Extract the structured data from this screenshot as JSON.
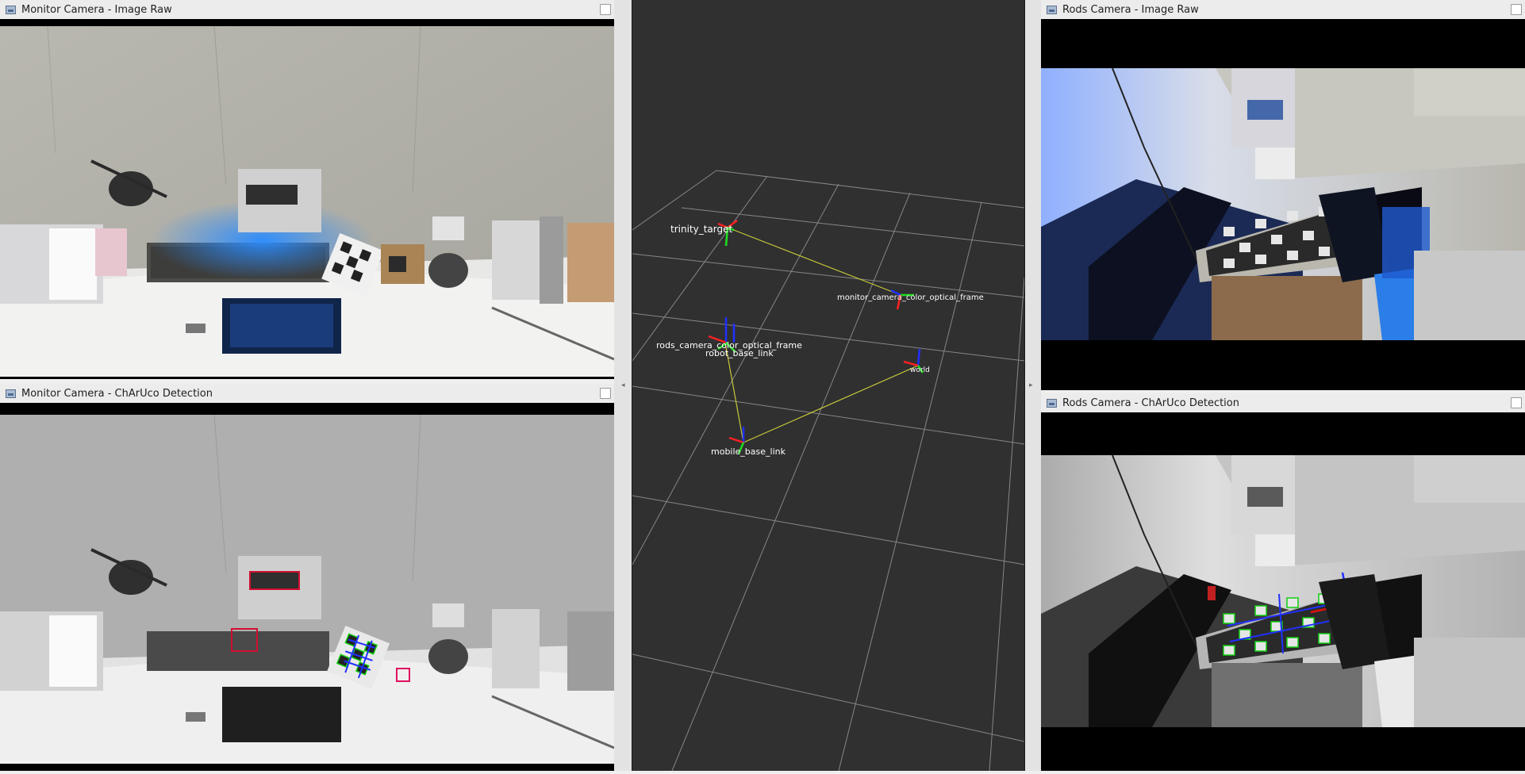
{
  "panels": {
    "monitor_raw": {
      "title": "Monitor Camera - Image Raw"
    },
    "monitor_charuco": {
      "title": "Monitor Camera - ChArUco Detection"
    },
    "rods_raw": {
      "title": "Rods Camera - Image Raw"
    },
    "rods_charuco": {
      "title": "Rods Camera - ChArUco Detection"
    }
  },
  "rviz": {
    "background_color": "#303030",
    "grid_color": "#a0a0a0",
    "link_color": "#c8c83c",
    "frames": {
      "trinity_target": "trinity_target",
      "monitor_camera_color_optical_frame": "monitor_camera_color_optical_frame",
      "rods_camera_color_optical_frame": "rods_camera_color_optical_frame",
      "robot_base_link": "robot_base_link",
      "world": "world",
      "mobile_base_link": "mobile_base_link"
    }
  },
  "colors": {
    "axis_x": "#ff2020",
    "axis_y": "#20e020",
    "axis_z": "#2030ff",
    "detection_blue": "#2030ff",
    "detection_green": "#10d010",
    "detection_red": "#e01010"
  },
  "icons": {
    "panel_icon": "image-view-icon",
    "close": "close-box-icon",
    "collapse_left": "arrow-left-icon",
    "collapse_right": "arrow-right-icon"
  }
}
